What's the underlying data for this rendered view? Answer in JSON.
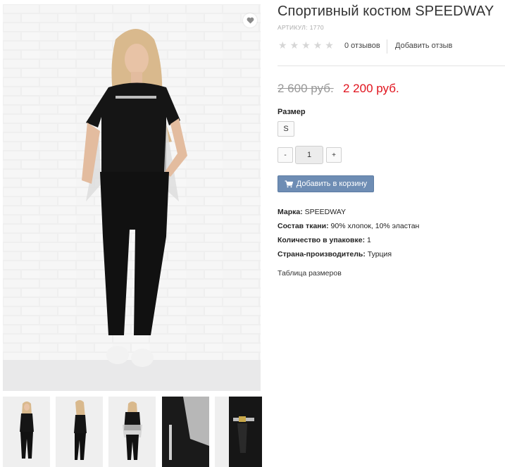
{
  "product": {
    "title": "Спортивный костюм SPEEDWAY",
    "sku_label": "АРТИКУЛ:",
    "sku_value": "1770"
  },
  "rating": {
    "stars": 0,
    "max_stars": 5,
    "reviews_label": "0 отзывов",
    "add_review_label": "Добавить отзыв"
  },
  "price": {
    "old": "2 600 руб.",
    "new": "2 200 руб.",
    "new_color": "#e0121c"
  },
  "options": {
    "size_label": "Размер",
    "sizes": [
      "S"
    ]
  },
  "quantity": {
    "minus": "-",
    "plus": "+",
    "value": "1"
  },
  "cart": {
    "button_label": "Добавить в корзину",
    "icon": "cart-icon",
    "color": "#6e8db4"
  },
  "properties": [
    {
      "name": "Марка:",
      "value": "SPEEDWAY"
    },
    {
      "name": "Состав ткани:",
      "value": "90% хлопок, 10% эластан"
    },
    {
      "name": "Количество в упаковке:",
      "value": "1"
    },
    {
      "name": "Страна-производитель:",
      "value": "Турция"
    }
  ],
  "size_table_link": "Таблица размеров",
  "gallery": {
    "favorite_icon": "heart-icon",
    "thumbnail_count": 5
  }
}
